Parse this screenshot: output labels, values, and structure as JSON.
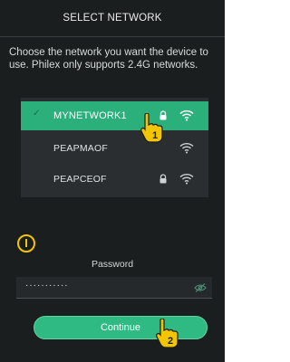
{
  "header": {
    "title": "SELECT NETWORK"
  },
  "description": "Choose the network you want the device to use. Philex only supports 2.4G networks.",
  "networks": [
    {
      "ssid": "MYNETWORK1",
      "selected": true,
      "locked": true,
      "wifi_icon": "wifi-icon"
    },
    {
      "ssid": "PEAPMAOF",
      "selected": false,
      "locked": false,
      "wifi_icon": "wifi-icon"
    },
    {
      "ssid": "PEAPCEOF",
      "selected": false,
      "locked": true,
      "wifi_icon": "wifi-icon"
    }
  ],
  "password": {
    "label": "Password",
    "value": "···········"
  },
  "continue_button": {
    "label": "Continue"
  },
  "annotations": {
    "step1": "1",
    "step2": "2"
  },
  "colors": {
    "accent": "#2bb07c",
    "background": "#1b1e1f",
    "callout": "#f2c500"
  }
}
